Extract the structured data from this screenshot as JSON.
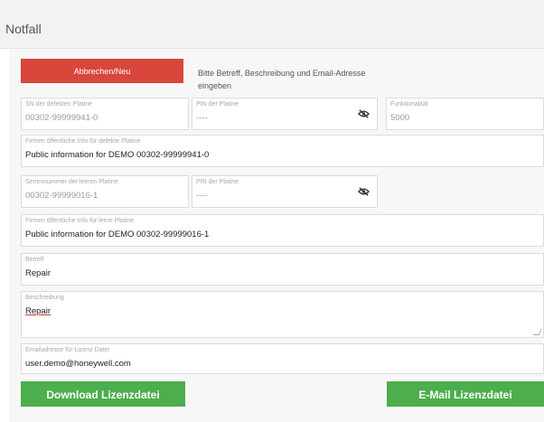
{
  "header": {
    "title": "Notfall"
  },
  "actions": {
    "cancel_label": "Abbrechen/Neu",
    "hint": "Bitte Betreff, Beschreibung und Email-Adresse eingeben",
    "download_label": "Download Lizenzdatei",
    "email_label": "E-Mail Lizenzdatei"
  },
  "defective": {
    "sn_label": "SN der defekten Platine",
    "sn_value": "00302-99999941-0",
    "pin_label": "PIN der Platine",
    "pin_value": "----",
    "func_label": "Funktionalität",
    "func_value": "5000",
    "info_label": "Firmen öffentliche Info für defekte Platine",
    "info_value": "Public information for DEMO 00302-99999941-0"
  },
  "empty": {
    "sn_label": "Seriennummer der leeren Platine",
    "sn_value": "00302-99999016-1",
    "pin_label": "PIN der Platine",
    "pin_value": "----",
    "info_label": "Firmen öffentliche Info für leere Platine",
    "info_value": "Public information for DEMO 00302-99999016-1"
  },
  "form": {
    "subject_label": "Betreff",
    "subject_value": "Repair",
    "description_label": "Beschreibung",
    "description_value": "Repair",
    "email_label": "Emailadresse für Lizenz Datei",
    "email_value": "user.demo@honeywell.com"
  },
  "icons": {
    "pin_toggle": "eye-slash-icon"
  },
  "colors": {
    "cancel": "#d9463b",
    "primary": "#4cae4c"
  }
}
